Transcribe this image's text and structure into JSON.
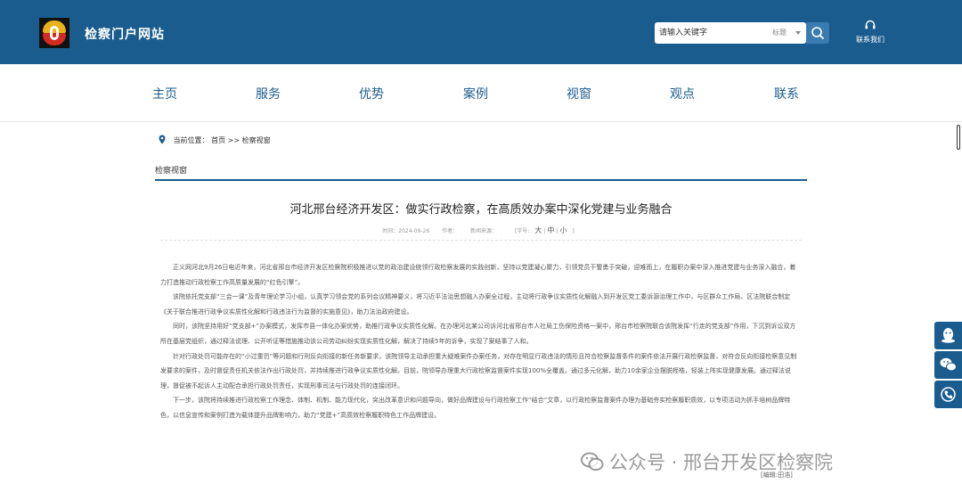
{
  "header": {
    "site_title": "检察门户网站",
    "search_placeholder": "请输入关键字",
    "search_scope": "标题",
    "contact_label": "联系我们"
  },
  "nav": [
    "主页",
    "服务",
    "优势",
    "案例",
    "视窗",
    "观点",
    "联系"
  ],
  "breadcrumb": {
    "prefix": "当前位置：",
    "home": "首页",
    "separator": ">>",
    "current": "检察视窗"
  },
  "section_title": "检察视窗",
  "article": {
    "title": "河北邢台经济开发区：做实行政检察，在高质效办案中深化党建与业务融合",
    "meta": {
      "time": "时间：2024-09-26",
      "author": "作者：",
      "source": "新闻来源：",
      "font_size_prefix": "[字号:",
      "size_large": "大",
      "size_medium": "中",
      "size_small": "小",
      "font_size_suffix": "]"
    },
    "paragraphs": [
      "正义网河北9月26日电近年来，河北省邢台市经济开发区检察院积极推进以党的政治建设统领行政检察发展的实践创新，坚持以党建凝心聚力，引领党员干警勇于突破，迎难而上，在履职办案中深入推进党建与业务深入融合，着力打造推动行政检察工作高质量发展的“红色引擎”。",
      "该院依托党支部“三会一课”及青年理论学习小组，认真学习领会党的系列会议精神要义，将习近平法治思想融入办案全过程，主动将行政争议实质性化解融入到开发区党工委诉源治理工作中，与区群众工作局、区法院联合制定《关于联合推进行政争议实质性化解和行政违法行为监督的实施意见》，助力法治政府建设。",
      "同时，该院坚持用好“党支部+”办案模式，发挥市县一体化办案优势，助推行政争议实质性化解。在办理河北某公司诉河北省邢台市人社局工伤保险资格一案中，邢台市检察院联合该院发挥“行走的党支部”作用，下沉到诉讼双方所在基层党组织，通过释法说理、公开听证等措施推动该公司劳动纠纷实现实质性化解，解决了持续5年的诉争，实现了案结事了人和。",
      "针对行政处罚可能存在的“小过重罚”等问题和行刑反向衔接的新任务新要求，该院领导主动承担重大疑难案件办案任务，对存在明显行政违法的情形且符合检察监督条件的案件依法开展行政检察监督，对符合反向衔接检察意见制发要求的案件，及时督促责任机关依法作出行政处罚，并持续推进行政争议实质性化解。目前，院领导办理重大行政检察监督案件实现100%全覆盖。通过多元化解，助力10余家企业摆脱桎梏，轻装上阵实现健康发展。通过释法说理，督促被不起诉人主动配合承担行政处罚责任，实现刑事司法与行政处罚的连接闭环。",
      "下一步，该院将持续推进行政检察工作理念、体制、机制、能力现代化，突出改革意识和问题导向，做好品牌建设与行政检察工作“结合”文章，以行政检察监督案件办理为基础夯实检察履职质效，以专项活动为抓手培树品牌特色，以信息宣传和案例打造为载体提升品牌影响力，助力“党建+”高质效检察履职特色工作品牌建设。"
    ],
    "editor": "[编辑:田浩]"
  },
  "watermark": "公众号 · 邢台开发区检察院",
  "icons": {
    "logo": "procuratorate-logo",
    "search": "search-icon",
    "contact": "headset-icon",
    "location": "map-pin-icon",
    "side": [
      "qq-icon",
      "wechat-icon",
      "phone-icon"
    ]
  },
  "colors": {
    "brand": "#1b5c8e",
    "search_button": "#3a7bb0"
  }
}
